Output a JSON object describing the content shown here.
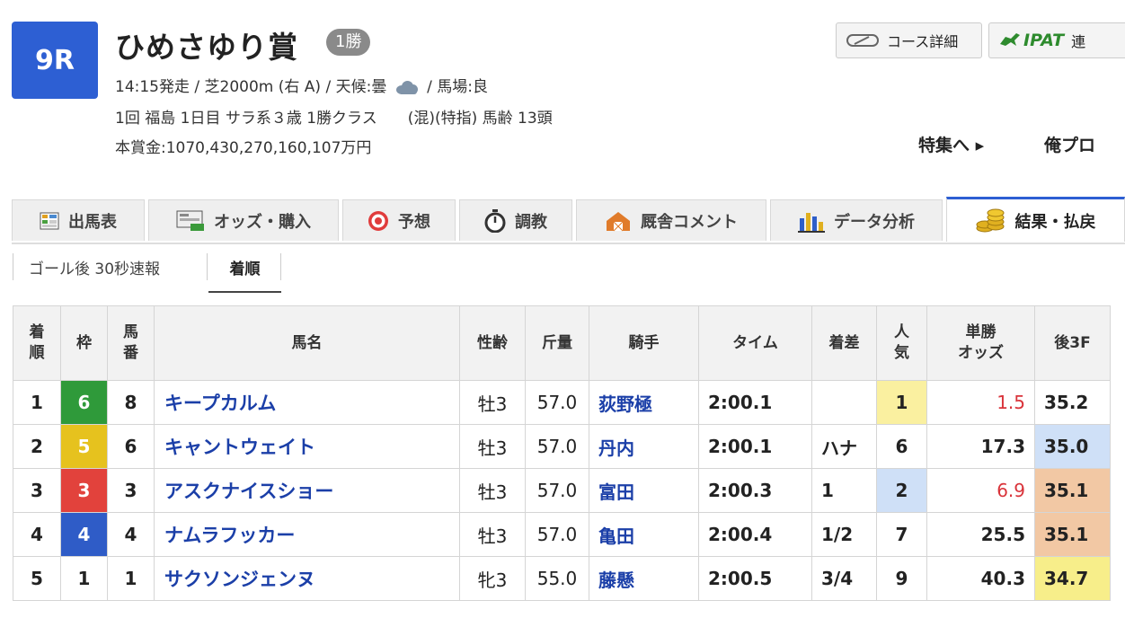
{
  "race": {
    "number": "9R",
    "name": "ひめさゆり賞",
    "class_badge": "1勝",
    "line1_pre": "14:15発走 / 芝2000m (右 A) / 天候:曇",
    "line1_post": "/ 馬場:良",
    "line2": "1回 福島 1日目 サラ系３歳 1勝クラス　　(混)(特指) 馬齢 13頭",
    "line3": "本賞金:1070,430,270,160,107万円"
  },
  "icons": {
    "weather": "cloud-icon"
  },
  "top_buttons": {
    "course": "コース詳細",
    "ipat": "IPAT",
    "ipat_suffix": "連"
  },
  "links": {
    "special": "特集へ ▸",
    "blog": "俺プロ"
  },
  "tabs": [
    {
      "label": "出馬表",
      "icon": "entry-table-icon"
    },
    {
      "label": "オッズ・購入",
      "icon": "odds-icon"
    },
    {
      "label": "予想",
      "icon": "target-icon"
    },
    {
      "label": "調教",
      "icon": "stopwatch-icon"
    },
    {
      "label": "厩舎コメント",
      "icon": "stable-icon"
    },
    {
      "label": "データ分析",
      "icon": "bar-chart-icon"
    },
    {
      "label": "結果・払戻",
      "icon": "coins-icon",
      "active": true
    }
  ],
  "subtabs": [
    "ゴール後 30秒速報",
    "着順"
  ],
  "table": {
    "headers": [
      "着\n順",
      "枠",
      "馬\n番",
      "馬名",
      "性齢",
      "斤量",
      "騎手",
      "タイム",
      "着差",
      "人\n気",
      "単勝\nオッズ",
      "後3F"
    ],
    "rows": [
      {
        "rank": "1",
        "waku": "6",
        "umaban": "8",
        "horse": "キープカルム",
        "sex_age": "牡3",
        "weight": "57.0",
        "jockey": "荻野極",
        "time": "2:00.1",
        "margin": "",
        "pop": "1",
        "odds": "1.5",
        "last3f": "35.2"
      },
      {
        "rank": "2",
        "waku": "5",
        "umaban": "6",
        "horse": "キャントウェイト",
        "sex_age": "牡3",
        "weight": "57.0",
        "jockey": "丹内",
        "time": "2:00.1",
        "margin": "ハナ",
        "pop": "6",
        "odds": "17.3",
        "last3f": "35.0"
      },
      {
        "rank": "3",
        "waku": "3",
        "umaban": "3",
        "horse": "アスクナイスショー",
        "sex_age": "牡3",
        "weight": "57.0",
        "jockey": "富田",
        "time": "2:00.3",
        "margin": "1",
        "pop": "2",
        "odds": "6.9",
        "last3f": "35.1"
      },
      {
        "rank": "4",
        "waku": "4",
        "umaban": "4",
        "horse": "ナムラフッカー",
        "sex_age": "牡3",
        "weight": "57.0",
        "jockey": "亀田",
        "time": "2:00.4",
        "margin": "1/2",
        "pop": "7",
        "odds": "25.5",
        "last3f": "35.1"
      },
      {
        "rank": "5",
        "waku": "1",
        "umaban": "1",
        "horse": "サクソンジェンヌ",
        "sex_age": "牝3",
        "weight": "55.0",
        "jockey": "藤懸",
        "time": "2:00.5",
        "margin": "3/4",
        "pop": "9",
        "odds": "40.3",
        "last3f": "34.7"
      }
    ]
  },
  "colors": {
    "race_badge": "#2d5fd3",
    "waku": {
      "1": "#ffffff",
      "3": "#e2423c",
      "4": "#2f5cc7",
      "5": "#e6c21e",
      "6": "#2f9a3a"
    },
    "pop_first": "#faf0a0",
    "pop_second": "#cfe0f7",
    "last3f_best": "#f7ee8a",
    "last3f_second": "#cfe0f7",
    "last3f_third": "#f2c8a4",
    "odds_red": "#d9333a",
    "link_blue": "#1b3fa8"
  }
}
